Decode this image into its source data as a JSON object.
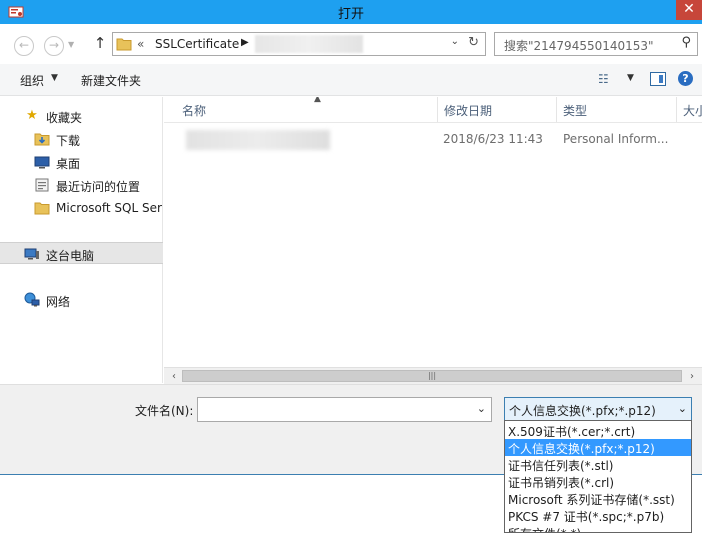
{
  "window": {
    "title": "打开"
  },
  "address": {
    "chevrons": "«",
    "folder": "SSLCertificate"
  },
  "search": {
    "placeholder": "搜索\"214794550140153\""
  },
  "toolbar": {
    "organize": "组织",
    "new_folder": "新建文件夹"
  },
  "navpane": {
    "favorites": "收藏夹",
    "items": [
      "下载",
      "桌面",
      "最近访问的位置",
      "Microsoft SQL Ser"
    ],
    "this_pc": "这台电脑",
    "network": "网络"
  },
  "columns": [
    "名称",
    "修改日期",
    "类型",
    "大小"
  ],
  "files": [
    {
      "date": "2018/6/23 11:43",
      "type": "Personal Inform..."
    }
  ],
  "bottom": {
    "filename_label": "文件名(N):",
    "filename_value": "",
    "filetype_selected": "个人信息交换(*.pfx;*.p12)"
  },
  "filetype_options": [
    "X.509证书(*.cer;*.crt)",
    "个人信息交换(*.pfx;*.p12)",
    "证书信任列表(*.stl)",
    "证书吊销列表(*.crl)",
    "Microsoft 系列证书存储(*.sst)",
    "PKCS #7 证书(*.spc;*.p7b)",
    "所有文件(*.*)"
  ],
  "colors": {
    "titlebar": "#1ea0f0",
    "close": "#c7463a",
    "selection": "#3399ff",
    "header_text": "#4c607a"
  },
  "icons": {
    "app": "certificate-icon",
    "back": "back-arrow-icon",
    "forward": "forward-arrow-icon",
    "up": "up-arrow-icon",
    "refresh": "refresh-icon",
    "search": "search-icon",
    "views": "view-options-icon",
    "preview_pane": "preview-pane-icon",
    "help": "help-icon"
  }
}
